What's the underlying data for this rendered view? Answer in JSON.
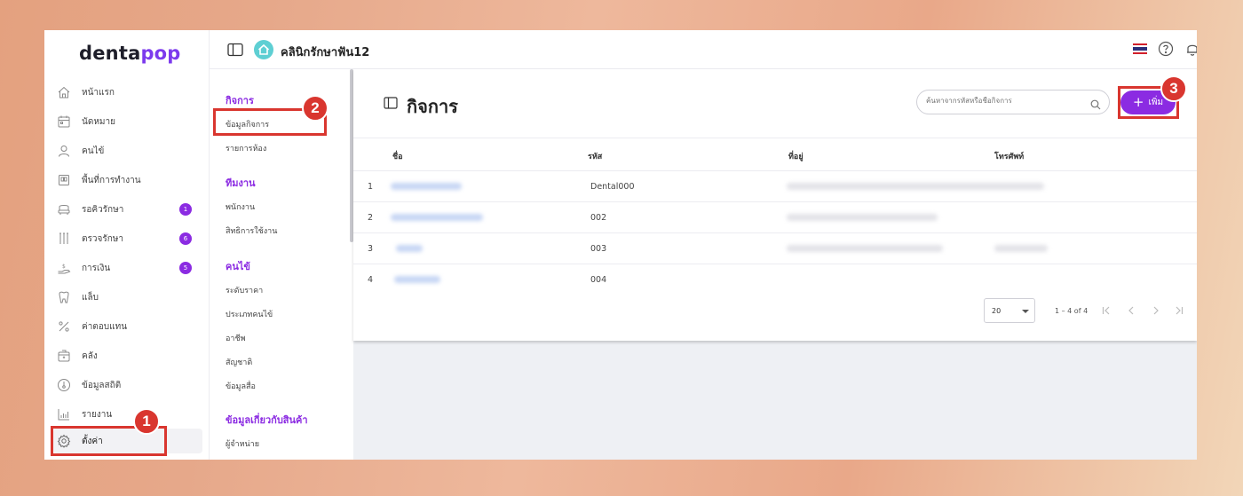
{
  "logo": {
    "part1": "denta",
    "part2": "pop"
  },
  "sidebar": {
    "items": [
      {
        "label": "หน้าแรก",
        "icon": "home-icon"
      },
      {
        "label": "นัดหมาย",
        "icon": "calendar-icon"
      },
      {
        "label": "คนไข้",
        "icon": "user-icon"
      },
      {
        "label": "พื้นที่การทำงาน",
        "icon": "workspace-icon"
      },
      {
        "label": "รอคิวรักษา",
        "icon": "dental-chair-icon",
        "badge": "1"
      },
      {
        "label": "ตรวจรักษา",
        "icon": "dental-tools-icon",
        "badge": "6"
      },
      {
        "label": "การเงิน",
        "icon": "money-hand-icon",
        "badge": "5"
      },
      {
        "label": "แล็บ",
        "icon": "tooth-icon"
      },
      {
        "label": "ค่าตอบแทน",
        "icon": "percent-icon"
      },
      {
        "label": "คลัง",
        "icon": "inventory-box-icon"
      },
      {
        "label": "ข้อมูลสถิติ",
        "icon": "thermometer-icon"
      },
      {
        "label": "รายงาน",
        "icon": "bar-chart-icon"
      },
      {
        "label": "ตั้งค่า",
        "icon": "gear-icon"
      }
    ]
  },
  "topbar": {
    "clinic_name": "คลินิกรักษาฟัน12"
  },
  "submenu": {
    "groups": [
      {
        "title": "กิจการ",
        "items": [
          "ข้อมูลกิจการ",
          "รายการห้อง"
        ]
      },
      {
        "title": "ทีมงาน",
        "items": [
          "พนักงาน",
          "สิทธิการใช้งาน"
        ]
      },
      {
        "title": "คนไข้",
        "items": [
          "ระดับราคา",
          "ประเภทคนไข้",
          "อาชีพ",
          "สัญชาติ",
          "ข้อมูลสื่อ"
        ]
      },
      {
        "title": "ข้อมูลเกี่ยวกับสินค้า",
        "items": [
          "ผู้จำหน่าย"
        ]
      }
    ]
  },
  "main": {
    "title": "กิจการ",
    "search_placeholder": "ค้นหาจากรหัสหรือชื่อกิจการ",
    "add_label": "เพิ่ม",
    "columns": [
      "ชื่อ",
      "รหัส",
      "ที่อยู่",
      "โทรศัพท์"
    ],
    "rows": [
      {
        "index": "1",
        "code": "Dental000"
      },
      {
        "index": "2",
        "code": "002"
      },
      {
        "index": "3",
        "code": "003"
      },
      {
        "index": "4",
        "code": "004"
      }
    ],
    "page_size": "20",
    "range": "1 – 4 of 4"
  },
  "annotations": [
    "1",
    "2",
    "3"
  ],
  "colors": {
    "accent": "#8b2be2",
    "highlight": "#d9362f",
    "clinic_icon": "#5ecfd3"
  }
}
